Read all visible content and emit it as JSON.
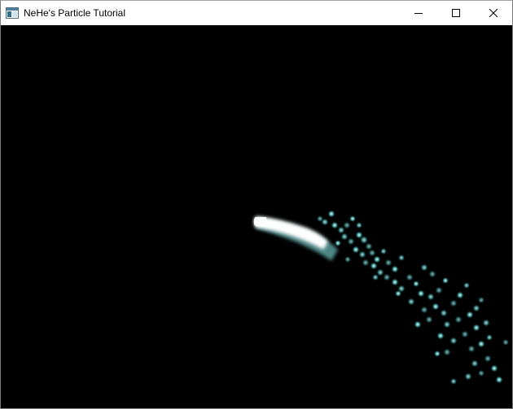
{
  "window": {
    "title": "NeHe's Particle Tutorial",
    "icon": "app-window-icon"
  },
  "controls": {
    "minimize": "minimize-icon",
    "maximize": "maximize-icon",
    "close": "close-icon"
  },
  "scene": {
    "background": "#000000",
    "particle_color": "#7ff2f2",
    "core_color": "#ffffff",
    "particle_count_visible": 0
  }
}
